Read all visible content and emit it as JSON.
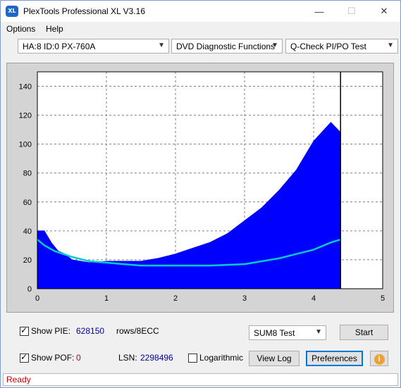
{
  "window": {
    "title": "PlexTools Professional XL V3.16",
    "icon_text": "XL"
  },
  "menu": {
    "items": [
      "Options",
      "Help"
    ]
  },
  "selectors": {
    "drive": "HA:8 ID:0  PX-760A",
    "function": "DVD Diagnostic Functions",
    "test": "Q-Check PI/PO Test"
  },
  "colors": {
    "bars": "#0000ff",
    "curve": "#00cccc",
    "plot_bg": "#ffffff",
    "frame_bg": "#d4d4d4",
    "status": "#c00000"
  },
  "chart_data": {
    "type": "area",
    "xlim": [
      0,
      5
    ],
    "ylim": [
      0,
      150
    ],
    "x_ticks": [
      "0",
      "1",
      "2",
      "3",
      "4",
      "5"
    ],
    "y_ticks": [
      "0",
      "20",
      "40",
      "60",
      "80",
      "100",
      "120",
      "140"
    ],
    "grid": true,
    "end_marker_x": 4.39,
    "series": [
      {
        "kind": "bars",
        "x": [
          0.0,
          0.1,
          0.2,
          0.3,
          0.4,
          0.5,
          0.75,
          1.0,
          1.25,
          1.5,
          1.75,
          2.0,
          2.25,
          2.5,
          2.75,
          3.0,
          3.25,
          3.5,
          3.75,
          4.0,
          4.25,
          4.39
        ],
        "values": [
          40,
          40,
          32,
          26,
          24,
          20,
          18,
          19,
          19,
          19,
          21,
          24,
          28,
          32,
          38,
          47,
          56,
          68,
          82,
          102,
          115,
          108
        ]
      },
      {
        "kind": "line",
        "x": [
          0.0,
          0.1,
          0.25,
          0.5,
          0.75,
          1.0,
          1.25,
          1.5,
          1.75,
          2.0,
          2.25,
          2.5,
          2.75,
          3.0,
          3.25,
          3.5,
          3.75,
          4.0,
          4.25,
          4.39
        ],
        "values": [
          34,
          30,
          26,
          22,
          19,
          18,
          17,
          16,
          16,
          16,
          16,
          16,
          16.5,
          17,
          19,
          21,
          24,
          27,
          32,
          34
        ]
      }
    ]
  },
  "controls": {
    "show_pie_label": "Show PIE:",
    "pie_value": "628150",
    "pie_unit": "rows/8ECC",
    "show_pof_label": "Show POF:",
    "pof_value": "0",
    "lsn_label": "LSN:",
    "lsn_value": "2298496",
    "logarithmic_label": "Logarithmic",
    "sum_select": "SUM8 Test",
    "start_button": "Start",
    "viewlog_button": "View Log",
    "preferences_button": "Preferences"
  },
  "status": {
    "text": "Ready"
  }
}
